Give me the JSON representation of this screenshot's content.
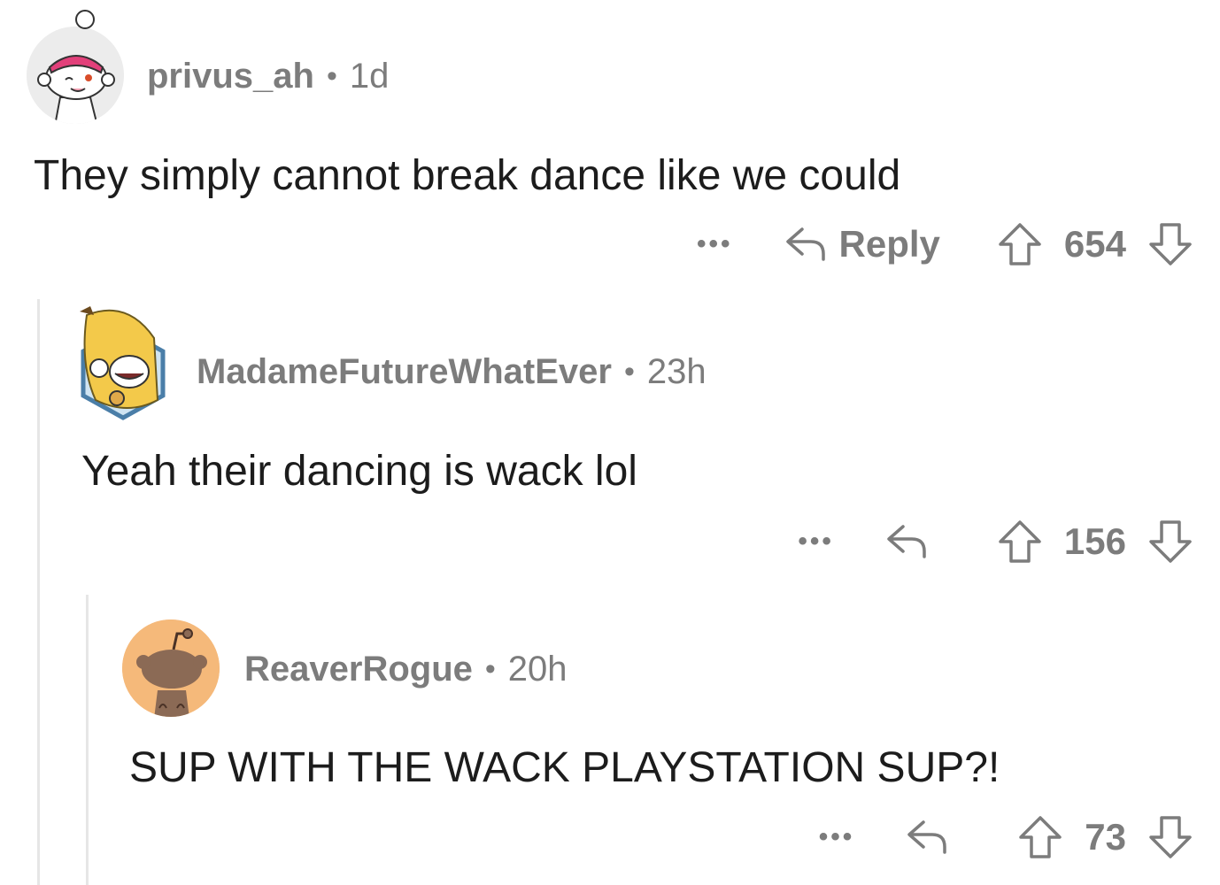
{
  "comments": [
    {
      "username": "privus_ah",
      "separator": "•",
      "time": "1d",
      "text": "They simply cannot break dance like we could",
      "more": "•••",
      "reply_label": "Reply",
      "score": "654",
      "avatar_icon": "snoo-avatar-pink-headband"
    },
    {
      "username": "MadameFutureWhatEver",
      "separator": "•",
      "time": "23h",
      "text": "Yeah their dancing is wack lol",
      "more": "•••",
      "reply_label": "",
      "score": "156",
      "avatar_icon": "snoo-avatar-banana"
    },
    {
      "username": "ReaverRogue",
      "separator": "•",
      "time": "20h",
      "text": "SUP WITH THE WACK PLAYSTATION SUP?!",
      "more": "•••",
      "reply_label": "",
      "score": "73",
      "avatar_icon": "snoo-avatar-default-orange"
    }
  ],
  "colors": {
    "meta_gray": "#7c7c7c",
    "thread_line": "#e6e6e6",
    "avatar_orange": "#f5b97a"
  }
}
